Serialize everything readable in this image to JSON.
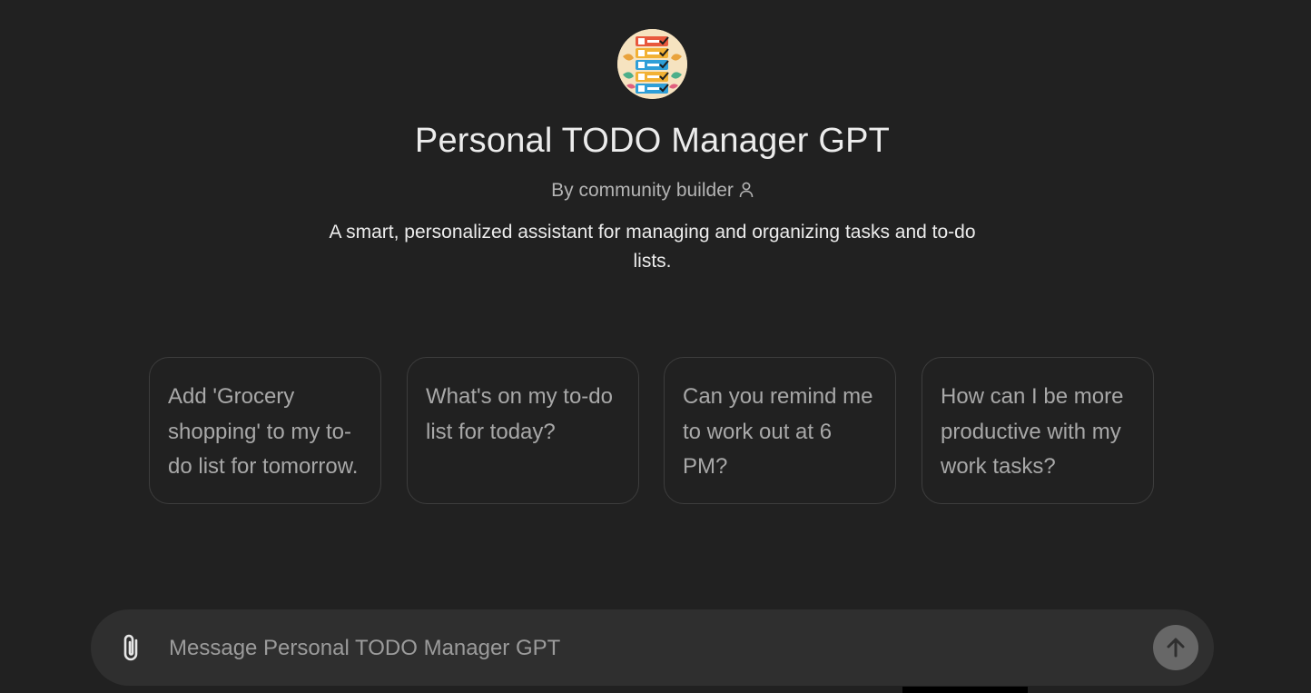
{
  "gpt": {
    "avatar_icon": "todo-checklist-avatar",
    "title": "Personal TODO Manager GPT",
    "byline": "By community builder",
    "description": "A smart, personalized assistant for managing and organizing tasks and to-do lists."
  },
  "conversation_starters": [
    {
      "label": "Add 'Grocery shopping' to my to-do list for tomorrow."
    },
    {
      "label": "What's on my to-do list for today?"
    },
    {
      "label": "Can you remind me to work out at 6 PM?"
    },
    {
      "label": "How can I be more productive with my work tasks?"
    }
  ],
  "composer": {
    "placeholder": "Message Personal TODO Manager GPT",
    "value": "",
    "attach_icon": "paperclip-icon",
    "send_icon": "arrow-up-icon"
  },
  "colors": {
    "background": "#212121",
    "composer": "#2f2f2f",
    "send_button": "#676767",
    "card_border": "#3d3d3d"
  }
}
